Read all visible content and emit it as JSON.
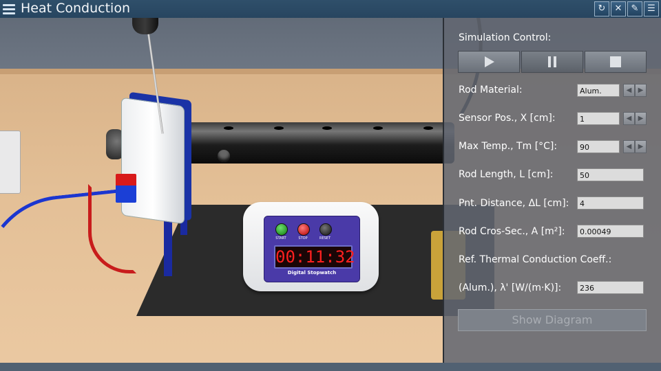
{
  "app": {
    "title": "Heat Conduction",
    "toolbar_icons": [
      "rotate-icon",
      "mute-icon",
      "edit-icon",
      "list-icon"
    ]
  },
  "scene": {
    "stopwatch": {
      "display": "00:11:32",
      "start_label": "START",
      "stop_label": "STOP",
      "reset_label": "RESET",
      "caption": "Digital Stopwatch"
    }
  },
  "panel": {
    "heading": "Simulation Control:",
    "controls": [
      "play-icon",
      "pause-icon",
      "stop-icon"
    ],
    "rows": [
      {
        "label": "Rod Material:",
        "value": "Alum.",
        "spinner": true
      },
      {
        "label": "Sensor Pos., X [cm]:",
        "value": "1",
        "spinner": true
      },
      {
        "label": "Max Temp., Tm [°C]:",
        "value": "90",
        "spinner": true
      },
      {
        "label": "Rod Length, L [cm]:",
        "value": "50",
        "spinner": false
      },
      {
        "label": "Pnt. Distance, ΔL [cm]:",
        "value": "4",
        "spinner": false
      },
      {
        "label": "Rod Cros-Sec., A [m²]:",
        "value": "0.00049",
        "spinner": false
      }
    ],
    "coeff_heading": "Ref. Thermal Conduction Coeff.:",
    "coeff_label": "(Alum.), λ' [W/(m·K)]:",
    "coeff_value": "236",
    "show_diagram_label": "Show Diagram"
  },
  "colors": {
    "title_bar": "#274560",
    "panel": "#62676f",
    "stopwatch_digits": "#ff2020"
  }
}
